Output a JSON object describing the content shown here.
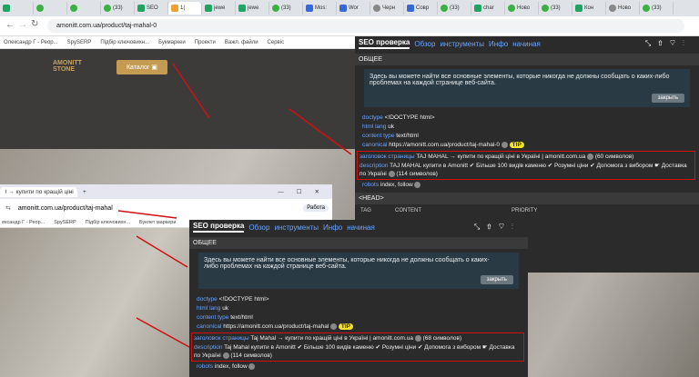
{
  "tabs": [
    {
      "label": "",
      "fav": "fg"
    },
    {
      "label": "",
      "fav": "fgr"
    },
    {
      "label": "",
      "fav": "fgr"
    },
    {
      "label": "(33)",
      "fav": "fgr"
    },
    {
      "label": "SEO",
      "fav": "fg"
    },
    {
      "label": "1(",
      "fav": "fo",
      "active": true
    },
    {
      "label": "jewe",
      "fav": "fg"
    },
    {
      "label": "jewe",
      "fav": "fg"
    },
    {
      "label": "(33)",
      "fav": "fgr"
    },
    {
      "label": "Mos:",
      "fav": "fb"
    },
    {
      "label": "Wor",
      "fav": "fb"
    },
    {
      "label": "Черн",
      "fav": "fgr2"
    },
    {
      "label": "Совр",
      "fav": "fb"
    },
    {
      "label": "(33)",
      "fav": "fgr"
    },
    {
      "label": "char",
      "fav": "fg"
    },
    {
      "label": "Ново",
      "fav": "fgr"
    },
    {
      "label": "(33)",
      "fav": "fgr"
    },
    {
      "label": "Кон",
      "fav": "fg"
    },
    {
      "label": "Ново",
      "fav": "fgr2"
    },
    {
      "label": "(33)",
      "fav": "fgr"
    }
  ],
  "url1": "amonitt.com.ua/product/taj-mahal-0",
  "bookmarks": [
    "Олександр Г - Реор...",
    "SpySERP",
    "Підбір ключовихн...",
    "Букмаркеи",
    "Проекти",
    "Важл. файли",
    "Сервіс"
  ],
  "site": {
    "logo_line1": "AMONITT",
    "logo_line2": "STONE",
    "catalog": "Каталог"
  },
  "seo": {
    "tabs": [
      "SEO проверка",
      "Обзор",
      "инструменты",
      "Инфо",
      "начиная"
    ],
    "section_general": "ОБЩЕЕ",
    "info_text": "Здесь вы можете найти все основные элементы, которые никогда не должны сообщать о каких-либо проблемах на каждой странице веб-сайта.",
    "close_label": "закрыть",
    "doctype_k": "doctype",
    "doctype_v": "<!DOCTYPE html>",
    "lang_k": "html lang",
    "lang_v": "uk",
    "ctype_k": "content type",
    "ctype_v": "text/html",
    "canon_k": "canonical",
    "canon_v1": "https://amonitt.com.ua/product/taj-mahal-0",
    "canon_v2": "https://amonitt.com.ua/product/taj-mahal",
    "tip": "TIP",
    "title_k": "заголовок страницы",
    "title_v": "TAJ MAHAL → купити по кращій ціні в Україні | amonitt.com.ua",
    "title_n": "(60 символов)",
    "title_v2": "Taj Mahal → купити по кращій ціні в Україні | amonitt.com.ua",
    "title_n2": "(68 символов)",
    "desc_k": "description",
    "desc_v": "TAJ MAHAL купити в Amonitt ✔ Більше 100 видів каменю ✔ Розумні ціни ✔ Допомога з вибором ☛ Доставка по Україні",
    "desc_v2": "Taj Mahal купити в Amonitt ✔ Більше 100 видів каменю ✔ Розумні ціни ✔ Допомога з вибором ☛ Доставка по Україні",
    "desc_n": "(114 символов)",
    "robots_k": "robots",
    "robots_v": "index, follow",
    "head_section": "<HEAD>",
    "cols": [
      "TAG",
      "CONTENT",
      "PRIORITY"
    ]
  },
  "win2": {
    "tab_label": "l → купити по кращій ціні",
    "new_tab": "+",
    "url": "amonitt.com.ua/product/taj-mahal",
    "work": "Работа",
    "bookmarks": [
      "ександр Г - Реор...",
      "SpySERP",
      "Підбір ключовихн...",
      "Буклет маркери"
    ]
  }
}
